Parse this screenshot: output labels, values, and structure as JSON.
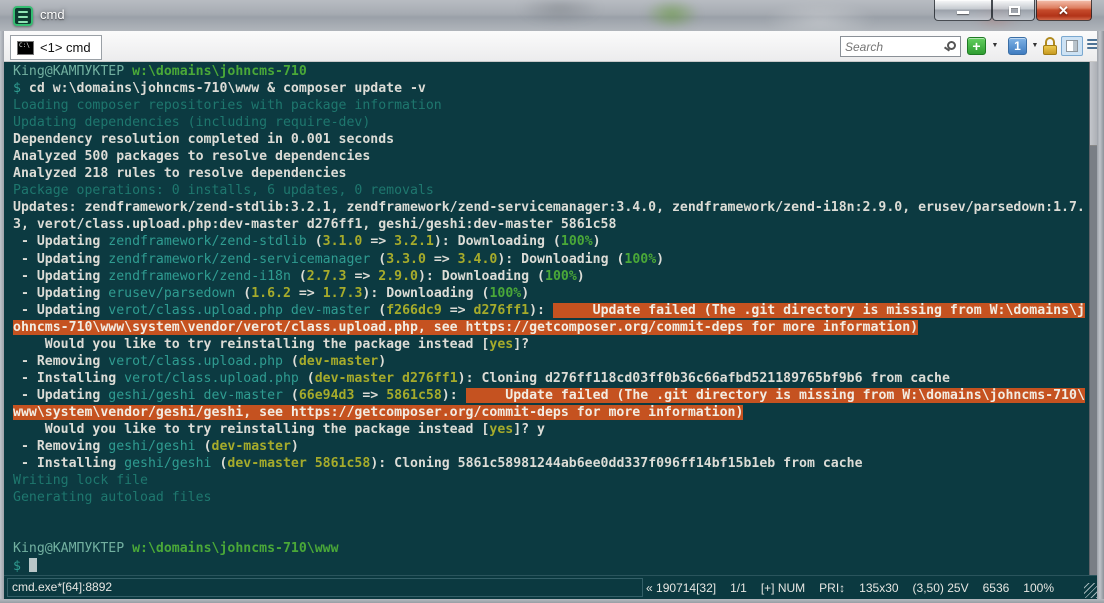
{
  "window": {
    "title": "cmd"
  },
  "titlebar": {
    "minimize_label": "minimize",
    "maximize_label": "maximize",
    "close_label": "close"
  },
  "tabbar": {
    "tab": {
      "label": "<1> cmd",
      "icon": "console-icon",
      "icon_text": "C:\\"
    },
    "search": {
      "placeholder": "Search",
      "value": ""
    },
    "buttons": {
      "new_console": "+",
      "active_console_number": "1"
    }
  },
  "colors": {
    "terminal_background": "#0c3a41",
    "error_highlight": "#c55220",
    "package_teal": "#2f9c91",
    "version_olive": "#a6ab2b",
    "success_green": "#4aa838",
    "prompt_seafoam": "#72b0a0",
    "bright_white": "#dcdcd6",
    "dim_teal": "#1e776e"
  },
  "terminal": {
    "cursor": true,
    "lines": [
      [
        [
          "pr",
          "King@КАМПУКТЕР"
        ],
        [
          "w",
          " "
        ],
        [
          "gr",
          "w:\\domains\\johncms-710"
        ]
      ],
      [
        [
          "cy",
          "$"
        ],
        [
          "w",
          " cd w:\\domains\\johncms-710\\www & composer update -v"
        ]
      ],
      [
        [
          "dim",
          "Loading composer repositories with package information"
        ]
      ],
      [
        [
          "dim",
          "Updating dependencies (including require-dev)"
        ]
      ],
      [
        [
          "w",
          "Dependency resolution completed in 0.001 seconds"
        ]
      ],
      [
        [
          "w",
          "Analyzed 500 packages to resolve dependencies"
        ]
      ],
      [
        [
          "w",
          "Analyzed 218 rules to resolve dependencies"
        ]
      ],
      [
        [
          "dim",
          "Package operations: 0 installs, 6 updates, 0 removals"
        ]
      ],
      [
        [
          "w",
          "Updates: zendframework/zend-stdlib:3.2.1, zendframework/zend-servicemanager:3.4.0, zendframework/zend-i18n:2.9.0, erusev/parsedown:1.7."
        ]
      ],
      [
        [
          "w",
          "3, verot/class.upload.php:dev-master d276ff1, geshi/geshi:dev-master 5861c58"
        ]
      ],
      [
        [
          "w",
          " - Updating "
        ],
        [
          "cy",
          "zendframework/zend-stdlib"
        ],
        [
          "w",
          " ("
        ],
        [
          "ol",
          "3.1.0"
        ],
        [
          "w",
          " => "
        ],
        [
          "ol",
          "3.2.1"
        ],
        [
          "w",
          "): Downloading ("
        ],
        [
          "gr",
          "100%"
        ],
        [
          "w",
          ")"
        ]
      ],
      [
        [
          "w",
          " - Updating "
        ],
        [
          "cy",
          "zendframework/zend-servicemanager"
        ],
        [
          "w",
          " ("
        ],
        [
          "ol",
          "3.3.0"
        ],
        [
          "w",
          " => "
        ],
        [
          "ol",
          "3.4.0"
        ],
        [
          "w",
          "): Downloading ("
        ],
        [
          "gr",
          "100%"
        ],
        [
          "w",
          ")"
        ]
      ],
      [
        [
          "w",
          " - Updating "
        ],
        [
          "cy",
          "zendframework/zend-i18n"
        ],
        [
          "w",
          " ("
        ],
        [
          "ol",
          "2.7.3"
        ],
        [
          "w",
          " => "
        ],
        [
          "ol",
          "2.9.0"
        ],
        [
          "w",
          "): Downloading ("
        ],
        [
          "gr",
          "100%"
        ],
        [
          "w",
          ")"
        ]
      ],
      [
        [
          "w",
          " - Updating "
        ],
        [
          "cy",
          "erusev/parsedown"
        ],
        [
          "w",
          " ("
        ],
        [
          "ol",
          "1.6.2"
        ],
        [
          "w",
          " => "
        ],
        [
          "ol",
          "1.7.3"
        ],
        [
          "w",
          "): Downloading ("
        ],
        [
          "gr",
          "100%"
        ],
        [
          "w",
          ")"
        ]
      ],
      [
        [
          "w",
          " - Updating "
        ],
        [
          "cy",
          "verot/class.upload.php dev-master"
        ],
        [
          "w",
          " ("
        ],
        [
          "ol",
          "f266dc9"
        ],
        [
          "w",
          " => "
        ],
        [
          "ol",
          "d276ff1"
        ],
        [
          "w",
          "): "
        ],
        [
          "err",
          "     Update failed (The .git directory is missing from W:\\domains\\j"
        ]
      ],
      [
        [
          "err",
          "ohncms-710\\www\\system\\vendor/verot/class.upload.php, see https://getcomposer.org/commit-deps for more information)"
        ]
      ],
      [
        [
          "w",
          "    Would you like to try reinstalling the package instead ["
        ],
        [
          "ol",
          "yes"
        ],
        [
          "w",
          "]?"
        ]
      ],
      [
        [
          "w",
          " - Removing "
        ],
        [
          "cy",
          "verot/class.upload.php"
        ],
        [
          "w",
          " ("
        ],
        [
          "ol",
          "dev-master"
        ],
        [
          "w",
          ")"
        ]
      ],
      [
        [
          "w",
          " - Installing "
        ],
        [
          "cy",
          "verot/class.upload.php"
        ],
        [
          "w",
          " ("
        ],
        [
          "ol",
          "dev-master d276ff1"
        ],
        [
          "w",
          "): Cloning d276ff118cd03ff0b36c66afbd521189765bf9b6 from cache"
        ]
      ],
      [
        [
          "w",
          " - Updating "
        ],
        [
          "cy",
          "geshi/geshi dev-master"
        ],
        [
          "w",
          " ("
        ],
        [
          "ol",
          "66e94d3"
        ],
        [
          "w",
          " => "
        ],
        [
          "ol",
          "5861c58"
        ],
        [
          "w",
          "): "
        ],
        [
          "err",
          "     Update failed (The .git directory is missing from W:\\domains\\johncms-710\\"
        ]
      ],
      [
        [
          "err",
          "www\\system\\vendor/geshi/geshi, see https://getcomposer.org/commit-deps for more information)"
        ]
      ],
      [
        [
          "w",
          "    Would you like to try reinstalling the package instead ["
        ],
        [
          "ol",
          "yes"
        ],
        [
          "w",
          "]? y"
        ]
      ],
      [
        [
          "w",
          " - Removing "
        ],
        [
          "cy",
          "geshi/geshi"
        ],
        [
          "w",
          " ("
        ],
        [
          "ol",
          "dev-master"
        ],
        [
          "w",
          ")"
        ]
      ],
      [
        [
          "w",
          " - Installing "
        ],
        [
          "cy",
          "geshi/geshi"
        ],
        [
          "w",
          " ("
        ],
        [
          "ol",
          "dev-master 5861c58"
        ],
        [
          "w",
          "): Cloning 5861c58981244ab6ee0dd337f096ff14bf15b1eb from cache"
        ]
      ],
      [
        [
          "dim",
          "Writing lock file"
        ]
      ],
      [
        [
          "dim",
          "Generating autoload files"
        ]
      ],
      [],
      [],
      [
        [
          "pr",
          "King@КАМПУКТЕР"
        ],
        [
          "w",
          " "
        ],
        [
          "gr",
          "w:\\domains\\johncms-710\\www"
        ]
      ],
      [
        [
          "cy",
          "$ "
        ]
      ]
    ]
  },
  "statusbar": {
    "left": "cmd.exe*[64]:8892",
    "right_items": [
      "« 190714[32]",
      "1/1",
      "[+] NUM",
      "PRI↕",
      "135x30",
      "(3,50) 25V",
      "6536",
      "100%"
    ]
  }
}
